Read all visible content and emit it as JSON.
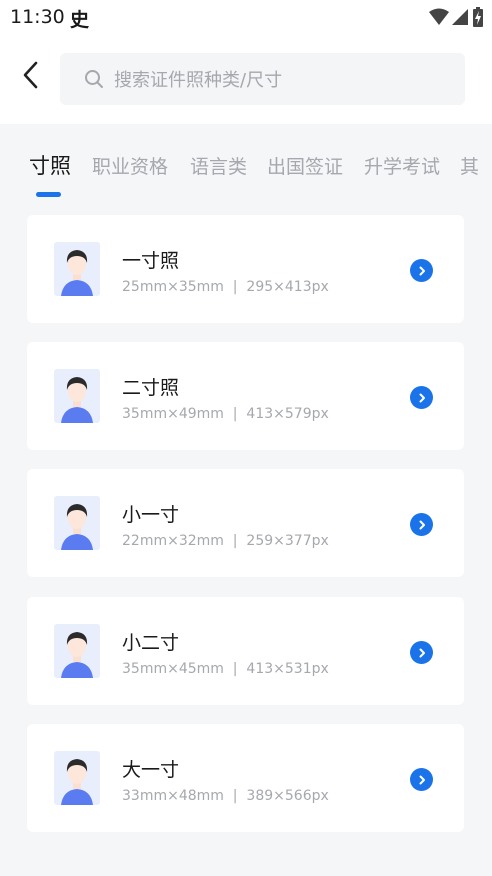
{
  "status_bar": {
    "time": "11:30",
    "app_icon_glyph": "史"
  },
  "search": {
    "placeholder": "搜索证件照种类/尺寸"
  },
  "tabs": [
    {
      "label": "寸照",
      "active": true
    },
    {
      "label": "职业资格",
      "active": false
    },
    {
      "label": "语言类",
      "active": false
    },
    {
      "label": "出国签证",
      "active": false
    },
    {
      "label": "升学考试",
      "active": false
    },
    {
      "label": "其",
      "active": false
    }
  ],
  "items": [
    {
      "name": "一寸照",
      "spec": "25mm×35mm  |  295×413px"
    },
    {
      "name": "二寸照",
      "spec": "35mm×49mm  |  413×579px"
    },
    {
      "name": "小一寸",
      "spec": "22mm×32mm  |  259×377px"
    },
    {
      "name": "小二寸",
      "spec": "35mm×45mm  |  413×531px"
    },
    {
      "name": "大一寸",
      "spec": "33mm×48mm  |  389×566px"
    }
  ],
  "colors": {
    "accent": "#1a73e8",
    "avatar_bg": "#e8eefb",
    "shirt": "#5b7bf0",
    "text_primary": "#1a1a1a",
    "text_secondary": "#a5a8ad"
  },
  "icons": {
    "back": "back-arrow-icon",
    "search": "search-icon",
    "wifi": "wifi-icon",
    "signal": "signal-icon",
    "battery": "battery-charging-icon",
    "go": "chevron-right-circle-icon",
    "avatar": "portrait-avatar-icon"
  }
}
